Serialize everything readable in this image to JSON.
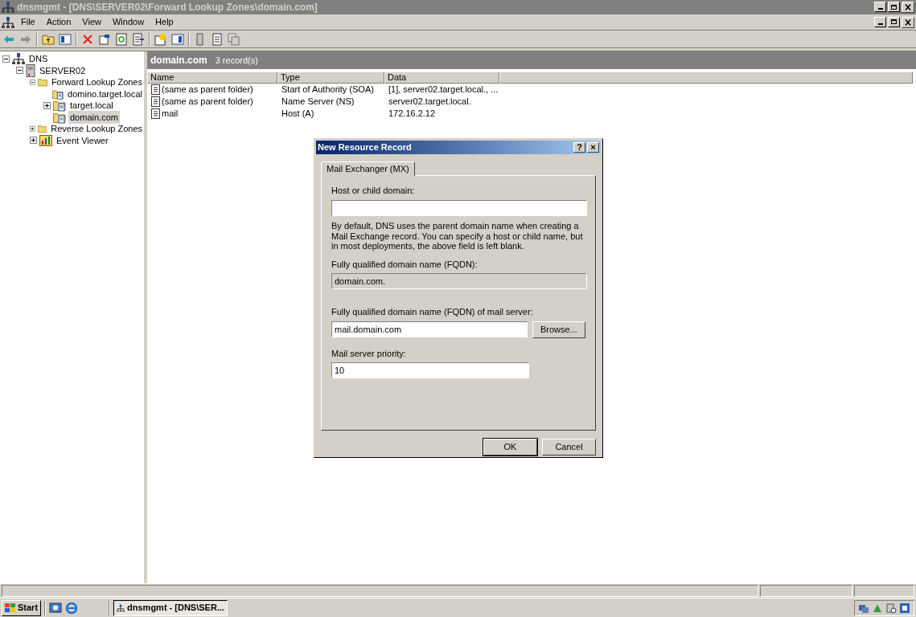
{
  "window": {
    "title": "dnsmgmt - [DNS\\SERVER02\\Forward Lookup Zones\\domain.com]"
  },
  "menu": [
    "File",
    "Action",
    "View",
    "Window",
    "Help"
  ],
  "tree": [
    {
      "label": "DNS",
      "kind": "dns",
      "expanded": true,
      "selected": false,
      "children": [
        {
          "label": "SERVER02",
          "kind": "server",
          "expanded": true,
          "selected": false,
          "children": [
            {
              "label": "Forward Lookup Zones",
              "kind": "folder",
              "expanded": true,
              "selected": false,
              "children": [
                {
                  "label": "domino.target.local",
                  "kind": "zone",
                  "selected": false
                },
                {
                  "label": "target.local",
                  "kind": "zone",
                  "expanded": false,
                  "selected": false
                },
                {
                  "label": "domain.com",
                  "kind": "zone",
                  "selected": true
                }
              ]
            },
            {
              "label": "Reverse Lookup Zones",
              "kind": "folder",
              "expanded": false,
              "selected": false
            },
            {
              "label": "Event Viewer",
              "kind": "events",
              "expanded": false,
              "selected": false
            }
          ]
        }
      ]
    }
  ],
  "pane": {
    "title": "domain.com",
    "count": "3 record(s)"
  },
  "table": {
    "columns": [
      "Name",
      "Type",
      "Data"
    ],
    "rows": [
      [
        "(same as parent folder)",
        "Start of Authority (SOA)",
        "[1], server02.target.local., ..."
      ],
      [
        "(same as parent folder)",
        "Name Server (NS)",
        "server02.target.local."
      ],
      [
        "mail",
        "Host (A)",
        "172.16.2.12"
      ]
    ]
  },
  "dialog": {
    "title": "New Resource Record",
    "help": "?",
    "close": "×",
    "tabs": [
      {
        "label": "Mail Exchanger (MX)",
        "selected": true
      }
    ],
    "host_label": "Host or child domain:",
    "note": "By default, DNS uses the parent domain name when creating a Mail Exchange record. You can specify a host or child name, but in most deployments, the above field is left blank.",
    "fqdn_label": "Fully qualified domain name (FQDN):",
    "fqdn_value": "domain.com.",
    "mail_label": "Fully qualified domain name (FQDN) of mail server:",
    "mail_value": "mail.domain.com",
    "browse": "Browse...",
    "priority_label": "Mail server priority:",
    "priority_value": "10",
    "buttons": [
      "OK",
      "Cancel"
    ]
  },
  "taskbar": {
    "start": "Start",
    "task": "dnsmgmt - [DNS\\SER..."
  }
}
